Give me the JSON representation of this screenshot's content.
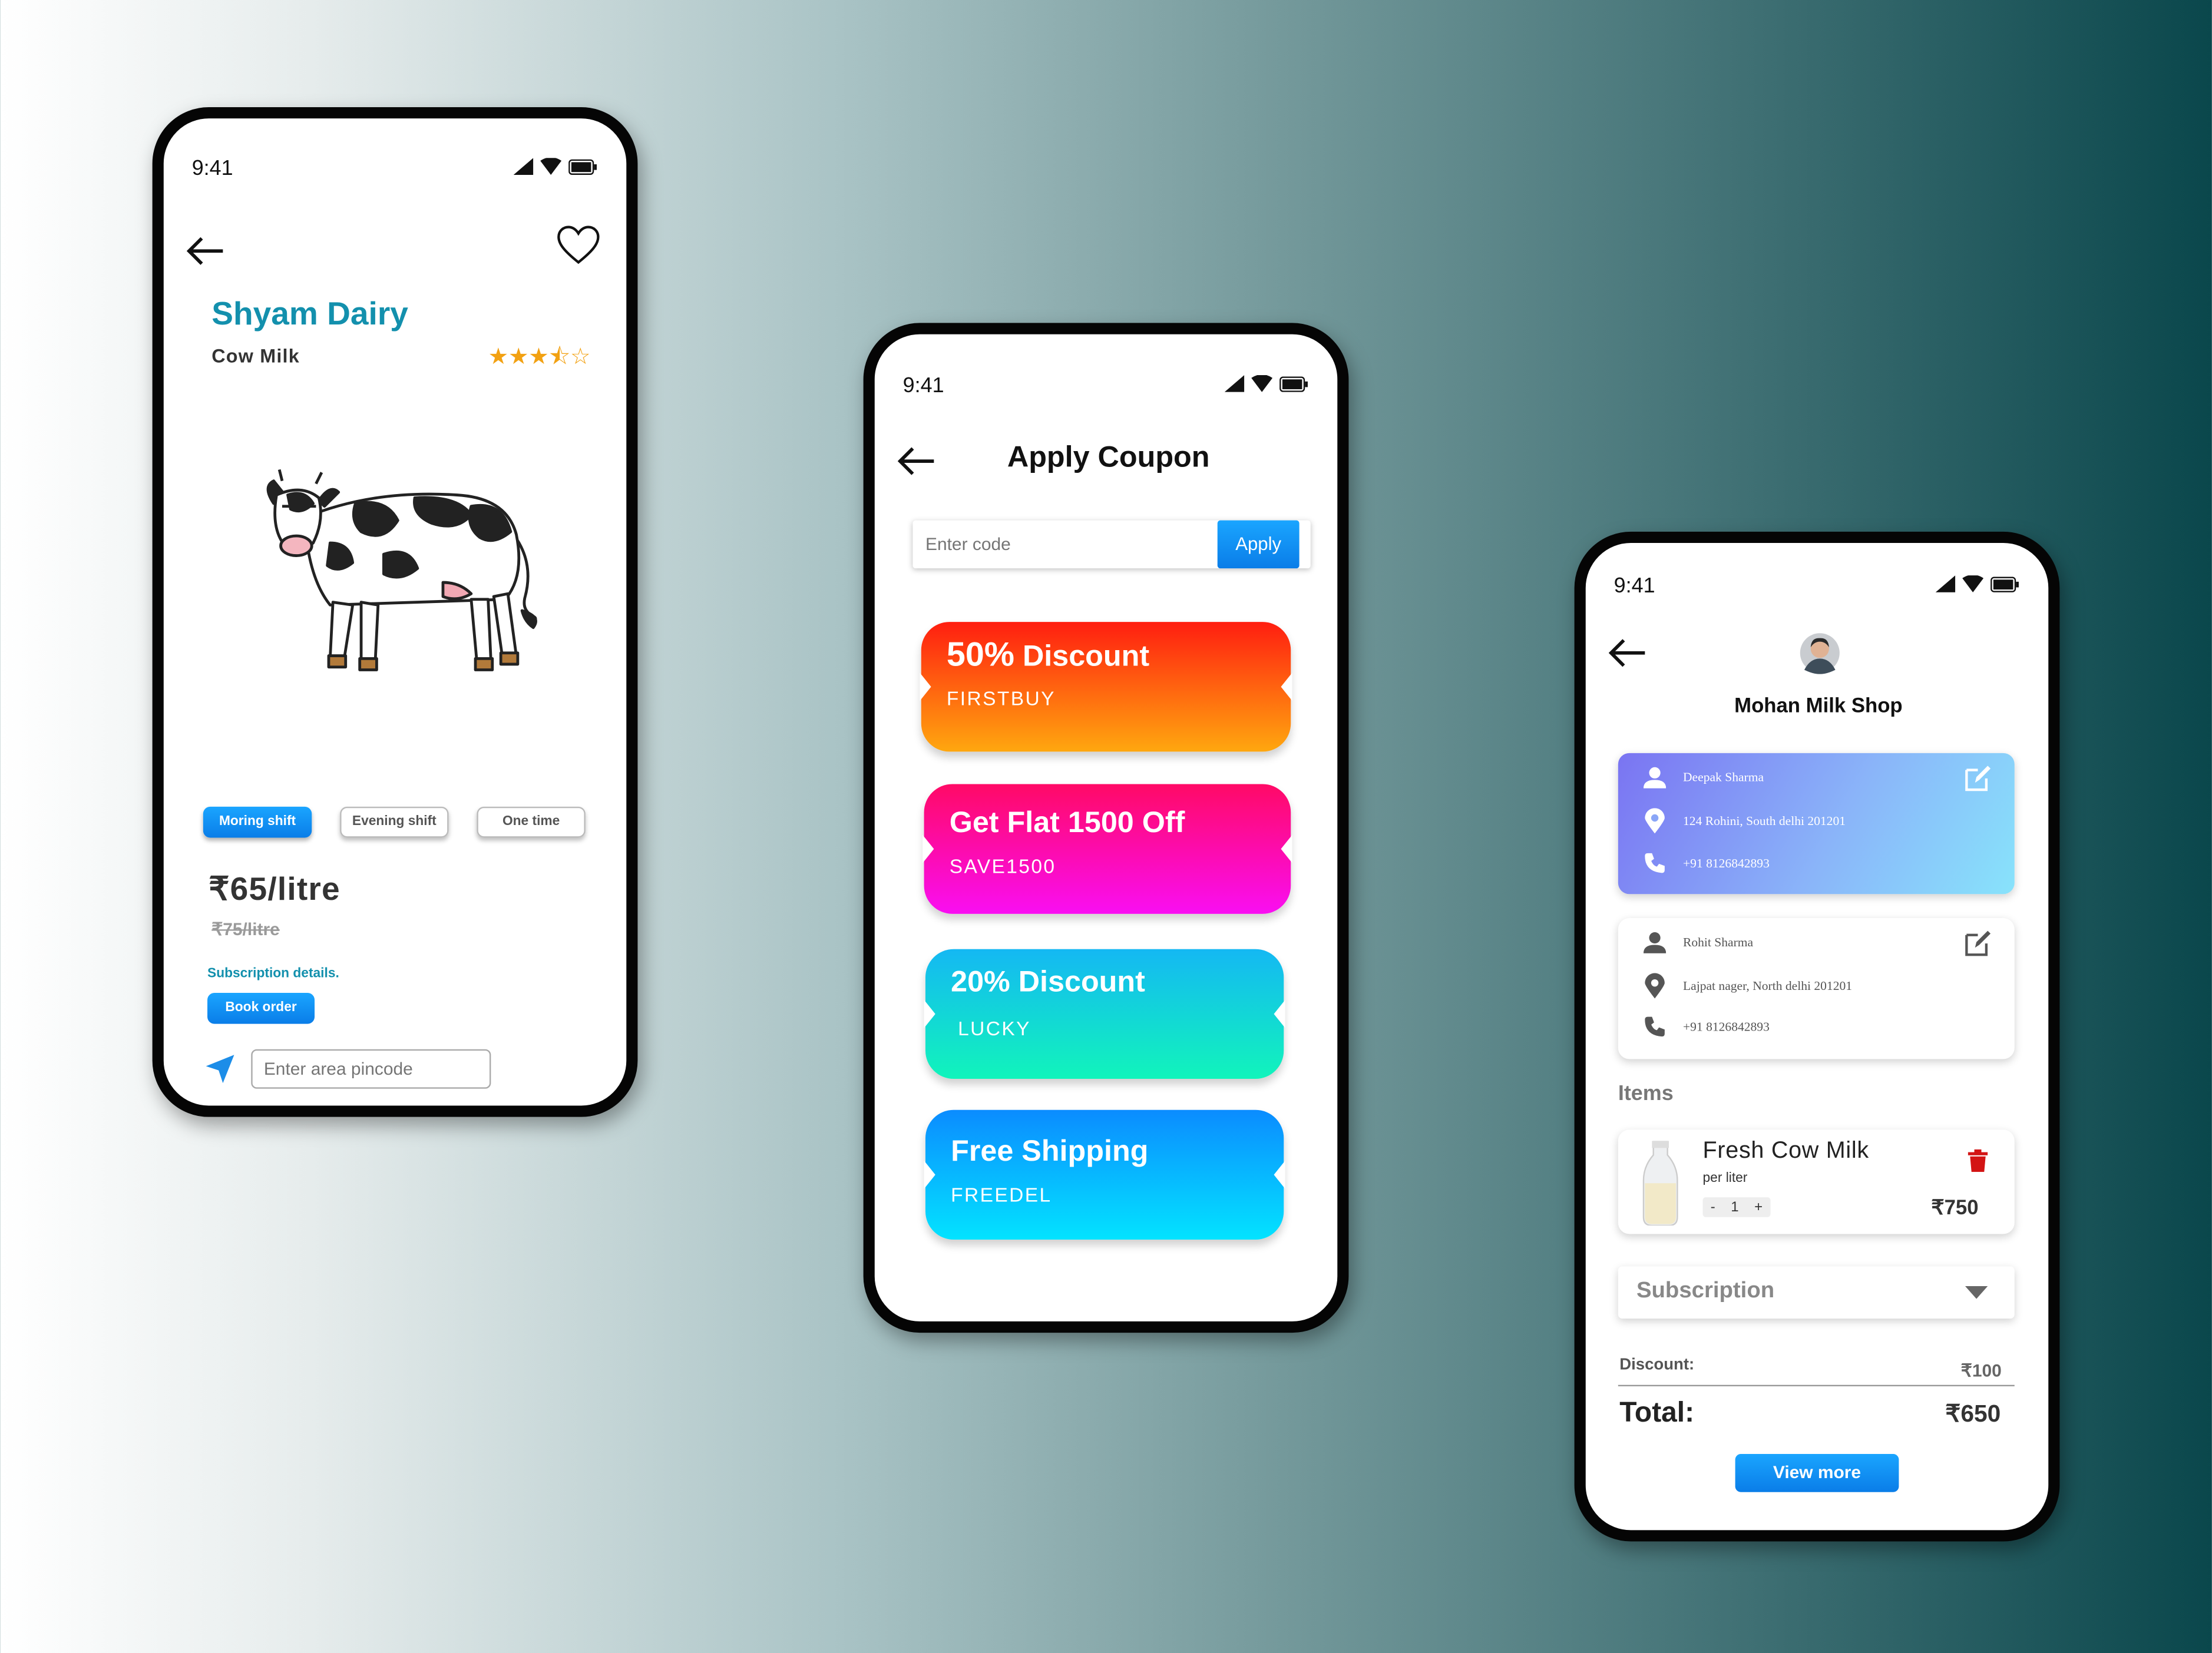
{
  "status_time": "9:41",
  "dairy": {
    "shop_name": "Shyam Dairy",
    "product": "Cow Milk",
    "rating": 3.5,
    "rating_max": 5,
    "shifts": [
      "Moring shift",
      "Evening shift",
      "One time"
    ],
    "price": "₹65/litre",
    "old_price": "₹75/litre",
    "subscription_link": "Subscription details.",
    "book_button": "Book order",
    "pincode_placeholder": "Enter area pincode"
  },
  "coupon": {
    "title": "Apply Coupon",
    "code_placeholder": "Enter code",
    "apply_button": "Apply",
    "items": [
      {
        "pct": "50%",
        "title": " Discount",
        "code": "FIRSTBUY",
        "gradient": [
          "#ff1e10",
          "#ffa70f"
        ]
      },
      {
        "pct": "",
        "title": "Get Flat 1500 Off",
        "code": "SAVE1500",
        "gradient": [
          "#ff0a66",
          "#f90ef2"
        ]
      },
      {
        "pct": "20%",
        "title": " Discount",
        "code": "LUCKY",
        "gradient": [
          "#14b8f3",
          "#11f4bb"
        ]
      },
      {
        "pct": "",
        "title": "Free Shipping",
        "code": "FREEDEL",
        "gradient": [
          "#0b8cff",
          "#03e3ff"
        ]
      }
    ]
  },
  "order": {
    "shop_name": "Mohan Milk Shop",
    "addresses": [
      {
        "name": "Deepak Sharma",
        "address": "124 Rohini, South delhi 201201",
        "phone": "+91 8126842893"
      },
      {
        "name": "Rohit Sharma",
        "address": "Lajpat nager, North delhi 201201",
        "phone": "+91 8126842893"
      }
    ],
    "items_heading": "Items",
    "item": {
      "name": "Fresh Cow Milk",
      "unit": "per liter",
      "qty_minus": "-",
      "qty": "1",
      "qty_plus": "+",
      "price": "₹750"
    },
    "subscription_label": "Subscription",
    "discount_label": "Discount:",
    "discount_value": "₹100",
    "total_label": "Total:",
    "total_value": "₹650",
    "view_more": "View more"
  }
}
